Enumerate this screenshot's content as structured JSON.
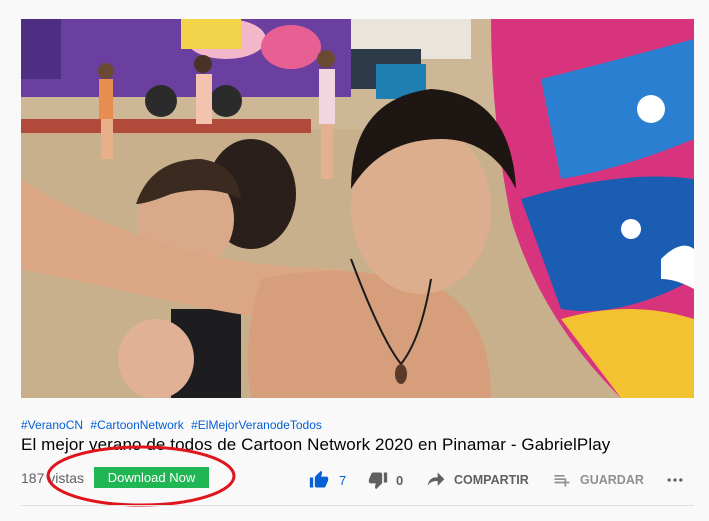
{
  "video": {
    "description_alt": ""
  },
  "hashtags": [
    "#VeranoCN",
    "#CartoonNetwork",
    "#ElMejorVeranodeTodos"
  ],
  "title": "El mejor verano de todos de Cartoon Network 2020 en Pinamar - GabrielPlay",
  "views": "187 vistas",
  "download_button": "Download Now",
  "actions": {
    "like_count": "7",
    "dislike_count": "0",
    "share_label": "COMPARTIR",
    "save_label": "GUARDAR"
  },
  "colors": {
    "link_blue": "#065fd4",
    "download_green": "#20b653",
    "annotation_red": "#e0141b"
  },
  "icons": [
    "thumbs-up-icon",
    "thumbs-down-icon",
    "share-arrow-icon",
    "playlist-add-icon",
    "more-horizontal-icon"
  ]
}
